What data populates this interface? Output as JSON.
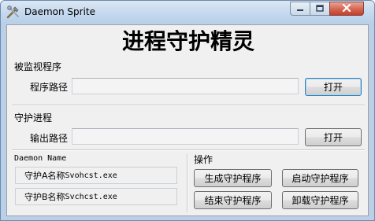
{
  "window": {
    "title": "Daemon Sprite",
    "icon": "wrench-hammer-icon",
    "controls": [
      "minimize-icon",
      "maximize-icon",
      "close-icon"
    ]
  },
  "main_title": "进程守护精灵",
  "monitored": {
    "group_label": "被监视程序",
    "path_label": "程序路径",
    "path_value": "",
    "open_button": "打开"
  },
  "daemon": {
    "group_label": "守护进程",
    "path_label": "输出路径",
    "path_value": "",
    "open_button": "打开"
  },
  "daemon_name": {
    "group_label": "Daemon Name",
    "a_label": "守护A名称",
    "a_value": "Svohcst.exe",
    "b_label": "守护B名称",
    "b_value": "Svchcst.exe"
  },
  "operations": {
    "group_label": "操作",
    "generate_button": "生成守护程序",
    "start_button": "启动守护程序",
    "end_button": "结束守护程序",
    "uninstall_button": "卸载守护程序"
  }
}
